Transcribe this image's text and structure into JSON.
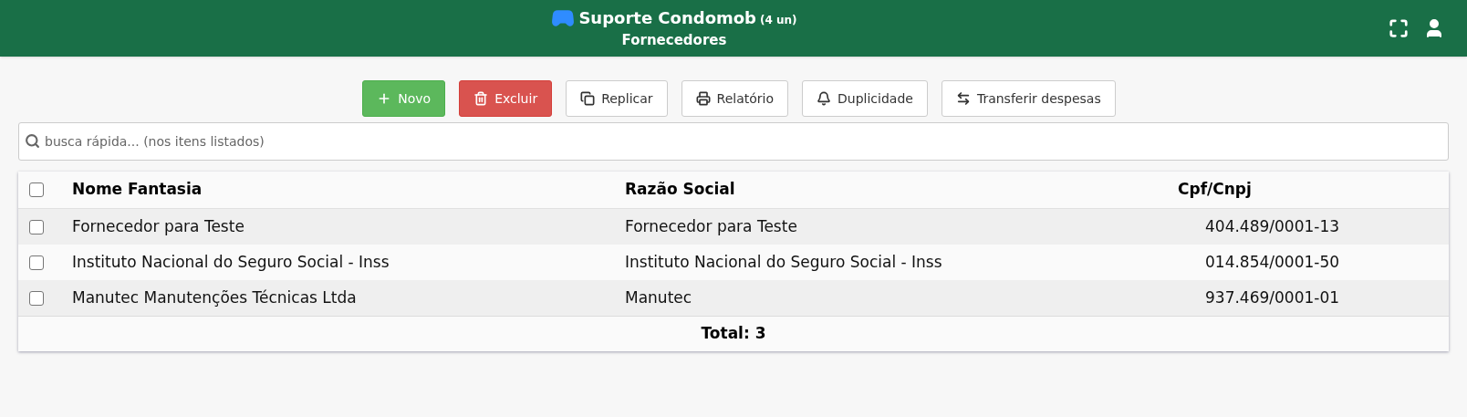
{
  "header": {
    "title": "Suporte Condomob",
    "count": "(4 un)",
    "subtitle": "Fornecedores"
  },
  "toolbar": [
    {
      "label": "Novo",
      "kind": "success"
    },
    {
      "label": "Excluir",
      "kind": "danger"
    },
    {
      "label": "Replicar",
      "kind": "default"
    },
    {
      "label": "Relatório",
      "kind": "default"
    },
    {
      "label": "Duplicidade",
      "kind": "default"
    },
    {
      "label": "Transferir despesas",
      "kind": "default"
    }
  ],
  "search": {
    "placeholder": "busca rápida... (nos itens listados)"
  },
  "table": {
    "select_all": {
      "checked": false
    },
    "columns": [
      "Nome Fantasia",
      "Razão Social",
      "Cpf/Cnpj"
    ],
    "rows": [
      {
        "checked": false,
        "cells": [
          "Fornecedor para Teste",
          "Fornecedor para Teste",
          "404.489/0001-13"
        ]
      },
      {
        "checked": false,
        "cells": [
          "Instituto Nacional do Seguro Social - Inss",
          "Instituto Nacional do Seguro Social - Inss",
          "014.854/0001-50"
        ]
      },
      {
        "checked": false,
        "cells": [
          "Manutec Manutenções Técnicas Ltda",
          "Manutec",
          "937.469/0001-01"
        ]
      }
    ],
    "footer": "Total: 3"
  }
}
